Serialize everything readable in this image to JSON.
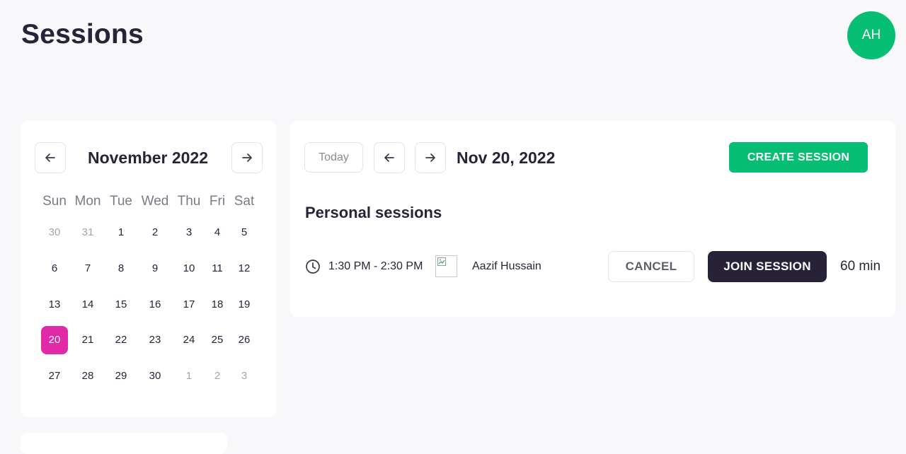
{
  "header": {
    "title": "Sessions",
    "avatar_initials": "AH",
    "avatar_color": "#06bf74"
  },
  "calendar": {
    "month_label": "November 2022",
    "prev_icon": "arrow-left-icon",
    "next_icon": "arrow-right-icon",
    "weekdays": [
      "Sun",
      "Mon",
      "Tue",
      "Wed",
      "Thu",
      "Fri",
      "Sat"
    ],
    "weeks": [
      [
        {
          "d": "30",
          "muted": true
        },
        {
          "d": "31",
          "muted": true
        },
        {
          "d": "1"
        },
        {
          "d": "2"
        },
        {
          "d": "3"
        },
        {
          "d": "4"
        },
        {
          "d": "5"
        }
      ],
      [
        {
          "d": "6"
        },
        {
          "d": "7"
        },
        {
          "d": "8"
        },
        {
          "d": "9"
        },
        {
          "d": "10"
        },
        {
          "d": "11"
        },
        {
          "d": "12"
        }
      ],
      [
        {
          "d": "13"
        },
        {
          "d": "14"
        },
        {
          "d": "15"
        },
        {
          "d": "16"
        },
        {
          "d": "17"
        },
        {
          "d": "18"
        },
        {
          "d": "19"
        }
      ],
      [
        {
          "d": "20",
          "selected": true
        },
        {
          "d": "21"
        },
        {
          "d": "22"
        },
        {
          "d": "23"
        },
        {
          "d": "24"
        },
        {
          "d": "25"
        },
        {
          "d": "26"
        }
      ],
      [
        {
          "d": "27"
        },
        {
          "d": "28"
        },
        {
          "d": "29"
        },
        {
          "d": "30"
        },
        {
          "d": "1",
          "muted": true
        },
        {
          "d": "2",
          "muted": true
        },
        {
          "d": "3",
          "muted": true
        }
      ]
    ],
    "selected_color": "#e12aa7"
  },
  "sessions_panel": {
    "today_label": "Today",
    "current_date": "Nov 20, 2022",
    "create_label": "CREATE SESSION",
    "create_color": "#06bf74",
    "section_title": "Personal sessions",
    "sessions": [
      {
        "time": "1:30 PM - 2:30 PM",
        "participant": "Aazif Hussain",
        "cancel_label": "CANCEL",
        "join_label": "JOIN SESSION",
        "duration": "60 min"
      }
    ],
    "join_color": "#272238"
  }
}
